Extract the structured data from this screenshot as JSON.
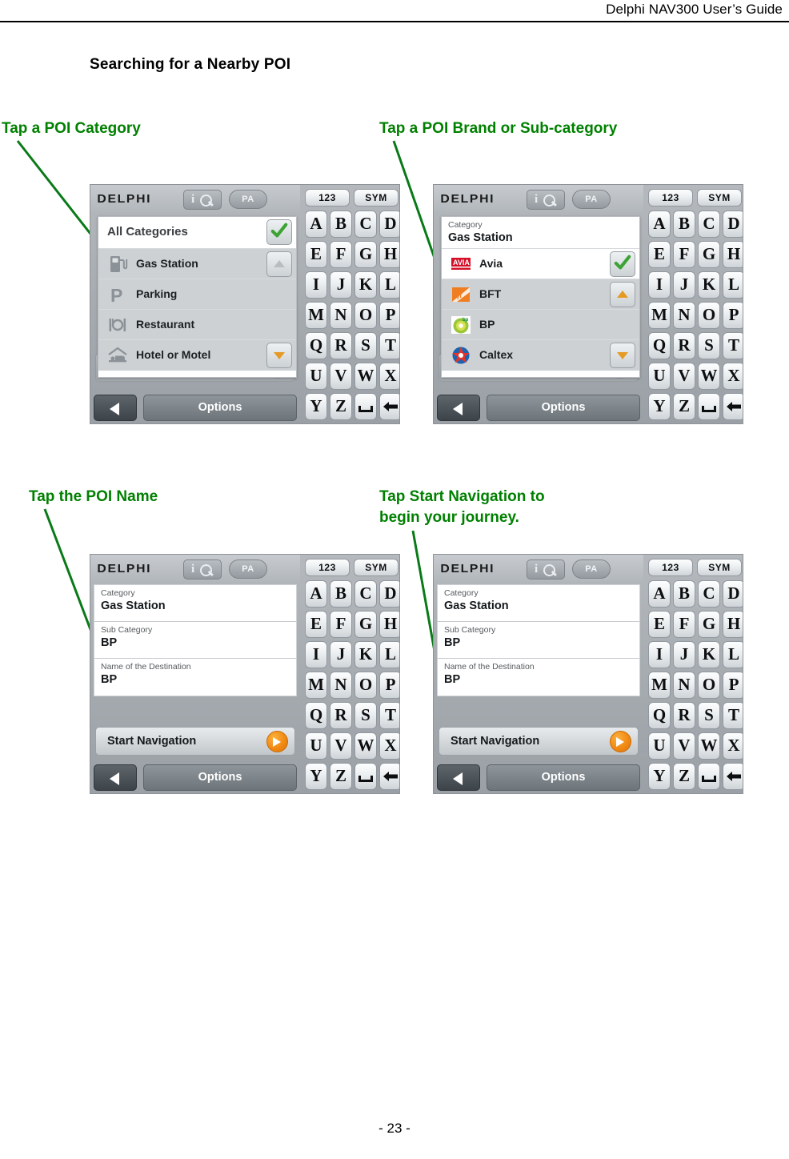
{
  "document": {
    "header": "Delphi NAV300 User’s Guide",
    "page_number": "- 23 -",
    "section_title": "Searching for a Nearby POI"
  },
  "callouts": [
    {
      "id": "callout-1",
      "text": "Tap a POI Category"
    },
    {
      "id": "callout-2",
      "text": "Tap a POI Brand or Sub-category"
    },
    {
      "id": "callout-3",
      "text": "Tap the POI Name"
    },
    {
      "id": "callout-4",
      "text": "Tap Start Navigation to\nbegin your journey."
    }
  ],
  "colors": {
    "annotation_green": "#008000",
    "accent_orange": "#f08711",
    "check_green": "#3da335",
    "text_black": "#000000"
  },
  "device_common": {
    "logo": "DELPHI",
    "pa_button": "PA",
    "iq_button_name": "info-search-icon",
    "options_button": "Options",
    "back_button_icon": "back-arrow-icon",
    "start_navigation": "Start Navigation",
    "keyboard": {
      "mode_keys": [
        "123",
        "SYM"
      ],
      "rows": [
        [
          "A",
          "B",
          "C",
          "D"
        ],
        [
          "E",
          "F",
          "G",
          "H"
        ],
        [
          "I",
          "J",
          "K",
          "L"
        ],
        [
          "M",
          "N",
          "O",
          "P"
        ],
        [
          "Q",
          "R",
          "S",
          "T"
        ],
        [
          "U",
          "V",
          "W",
          "X"
        ],
        [
          "Y",
          "Z",
          "space",
          "backspace"
        ]
      ]
    }
  },
  "screens": [
    {
      "id": "screen-poi-category",
      "popup_header": "All Categories",
      "popup_header_has_check": true,
      "start_navigation_enabled": false,
      "rows": [
        {
          "label": "Gas Station",
          "icon": "gas-pump-icon",
          "selected": true
        },
        {
          "label": "Parking",
          "icon": "parking-p-icon",
          "selected": false
        },
        {
          "label": "Restaurant",
          "icon": "cutlery-icon",
          "selected": false
        },
        {
          "label": "Hotel or Motel",
          "icon": "bed-icon",
          "selected": false
        }
      ]
    },
    {
      "id": "screen-poi-brand",
      "info_rows": [
        {
          "label": "Category",
          "value": "Gas Station"
        }
      ],
      "popup_header": "",
      "start_navigation_enabled": false,
      "rows": [
        {
          "label": "Avia",
          "icon": "avia-logo-icon",
          "selected": false,
          "white": true
        },
        {
          "label": "BFT",
          "icon": "bft-logo-icon",
          "selected": false
        },
        {
          "label": "BP",
          "icon": "bp-logo-icon",
          "selected": true
        },
        {
          "label": "Caltex",
          "icon": "caltex-logo-icon",
          "selected": false
        }
      ]
    },
    {
      "id": "screen-poi-name",
      "info_rows": [
        {
          "label": "Category",
          "value": "Gas Station"
        },
        {
          "label": "Sub Category",
          "value": "BP"
        },
        {
          "label": "Name of the Destination",
          "value": "BP"
        }
      ],
      "start_navigation_enabled": true
    },
    {
      "id": "screen-start-navigation",
      "info_rows": [
        {
          "label": "Category",
          "value": "Gas Station"
        },
        {
          "label": "Sub Category",
          "value": "BP"
        },
        {
          "label": "Name of the Destination",
          "value": "BP"
        }
      ],
      "start_navigation_enabled": true
    }
  ]
}
